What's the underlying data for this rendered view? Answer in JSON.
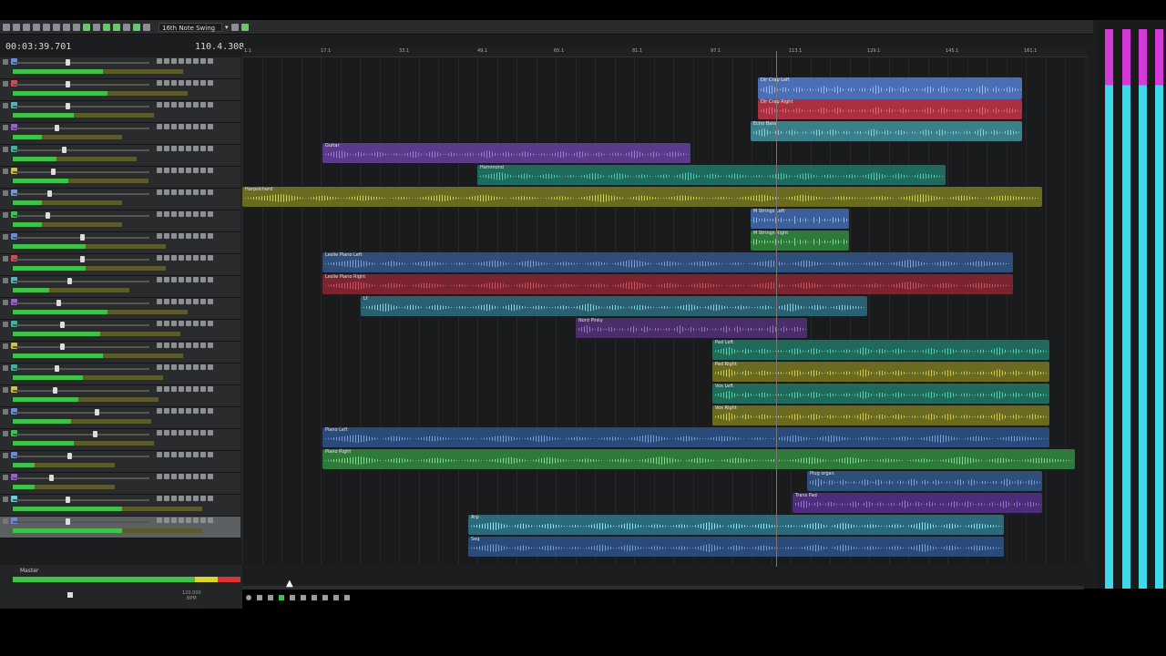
{
  "toolbar": {
    "snap_label": "16th Note Swing"
  },
  "time": {
    "clock": "00:03:39.701",
    "measure": "110.4.308"
  },
  "ruler": {
    "ticks": [
      "1.1",
      "17.1",
      "33.1",
      "49.1",
      "65.1",
      "81.1",
      "97.1",
      "113.1",
      "129.1",
      "145.1",
      "161.1"
    ]
  },
  "tracks": [
    {
      "color": "#6b8bd6",
      "level": 0.62
    },
    {
      "color": "#d64a5a",
      "level": 0.65
    },
    {
      "color": "#5fb0b8",
      "level": 0.42
    },
    {
      "color": "#9b5fd0",
      "level": 0.2
    },
    {
      "color": "#39b39a",
      "level": 0.3
    },
    {
      "color": "#c8c24a",
      "level": 0.38
    },
    {
      "color": "#7b94d6",
      "level": 0.2
    },
    {
      "color": "#3ec24a",
      "level": 0.2
    },
    {
      "color": "#6b8bd6",
      "level": 0.5
    },
    {
      "color": "#d64a5a",
      "level": 0.5
    },
    {
      "color": "#5fb0b8",
      "level": 0.25
    },
    {
      "color": "#9b5fd0",
      "level": 0.65
    },
    {
      "color": "#39b39a",
      "level": 0.6
    },
    {
      "color": "#c8c24a",
      "level": 0.62
    },
    {
      "color": "#39b39a",
      "level": 0.48
    },
    {
      "color": "#c8c24a",
      "level": 0.45
    },
    {
      "color": "#6b8bd6",
      "level": 0.4
    },
    {
      "color": "#3ec24a",
      "level": 0.42
    },
    {
      "color": "#6b8bd6",
      "level": 0.15
    },
    {
      "color": "#9b5fd0",
      "level": 0.15
    },
    {
      "color": "#5fd0d8",
      "level": 0.75
    },
    {
      "color": "#6b8bd6",
      "level": 0.75
    }
  ],
  "clips": [
    {
      "name": "Dir Crap Left",
      "color": "#4a6fb5",
      "wave": "#9db8ef"
    },
    {
      "name": "Dir Crap Right",
      "color": "#a83040",
      "wave": "#e46a78"
    },
    {
      "name": "Echo Bass",
      "color": "#3a7f8a",
      "wave": "#7fd6e0"
    },
    {
      "name": "Guitar",
      "color": "#5a3a8a",
      "wave": "#a47ad8"
    },
    {
      "name": "Hammond",
      "color": "#1e6a5c",
      "wave": "#4fd0b0"
    },
    {
      "name": "Harpsichord",
      "color": "#6a6a20",
      "wave": "#d8d050"
    },
    {
      "name": "M Strings Left",
      "color": "#3a5f9a",
      "wave": "#9ab8ee"
    },
    {
      "name": "M Strings Right",
      "color": "#2f7a3a",
      "wave": "#7fe08a"
    },
    {
      "name": "Leslie Piano Left",
      "color": "#2f4f7a",
      "wave": "#7ea2e0"
    },
    {
      "name": "Leslie Piano Right",
      "color": "#7a2430",
      "wave": "#d65262"
    },
    {
      "name": "Lf",
      "color": "#2a6070",
      "wave": "#7fd8e4"
    },
    {
      "name": "Nord Pinky",
      "color": "#4a2e6a",
      "wave": "#a070d0"
    },
    {
      "name": "Pad Left",
      "color": "#1f6a58",
      "wave": "#55d6b2"
    },
    {
      "name": "Pad Right",
      "color": "#6a6a20",
      "wave": "#d8cc48"
    },
    {
      "name": "Vox Left",
      "color": "#1f6a58",
      "wave": "#55d6b2"
    },
    {
      "name": "Vox Right",
      "color": "#6a6a20",
      "wave": "#d8cc48"
    },
    {
      "name": "Piano Left",
      "color": "#2a4a7a",
      "wave": "#7aa0e0"
    },
    {
      "name": "Piano Right",
      "color": "#2f7a3a",
      "wave": "#7fe08a"
    },
    {
      "name": "Plug organ",
      "color": "#2f4f7a",
      "wave": "#7ea2e0"
    },
    {
      "name": "Trans Pad",
      "color": "#4a2e7a",
      "wave": "#a070e0"
    },
    {
      "name": "Arp",
      "color": "#2a6a7a",
      "wave": "#8fe8f0"
    },
    {
      "name": "Seq",
      "color": "#2a4a7a",
      "wave": "#7aa0e0"
    }
  ],
  "master": {
    "label": "Master",
    "bpm": "120.000",
    "bpm_unit": "BPM"
  }
}
